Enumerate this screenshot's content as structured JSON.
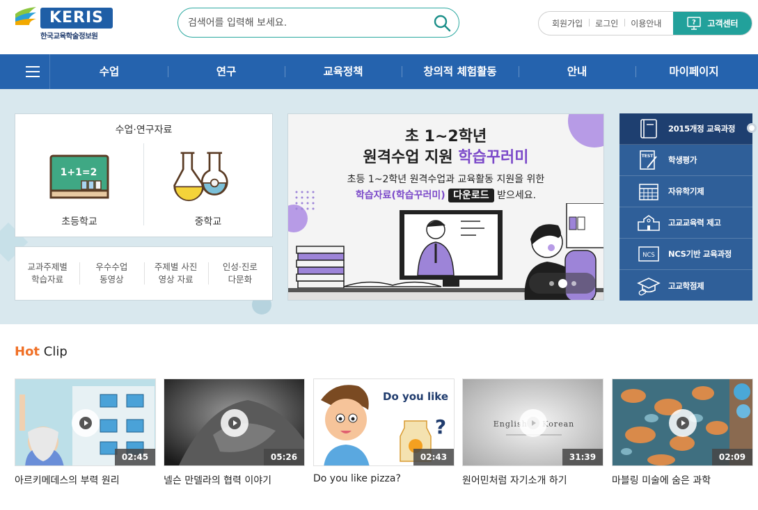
{
  "header": {
    "logo_text": "KERIS",
    "logo_subtitle": "한국교육학술정보원",
    "search_placeholder": "검색어를 입력해 보세요.",
    "util_links": [
      "회원가입",
      "로그인",
      "이용안내"
    ],
    "customer_center": "고객센터"
  },
  "nav": {
    "items": [
      "수업",
      "연구",
      "교육정책",
      "창의적 체험활동",
      "안내",
      "마이페이지"
    ]
  },
  "resources": {
    "title": "수업·연구자료",
    "items": [
      "초등학교",
      "중학교"
    ],
    "board_text": "1+1=2",
    "links": [
      {
        "line1": "교과주제별",
        "line2": "학습자료"
      },
      {
        "line1": "우수수업",
        "line2": "동영상"
      },
      {
        "line1": "주제별 사진",
        "line2": "영상 자료"
      },
      {
        "line1": "인성·진로",
        "line2": "다문화"
      }
    ]
  },
  "banner": {
    "line1": "초 1~2학년",
    "line2_pre": "원격수업 지원 ",
    "line2_highlight": "학습꾸러미",
    "line3": "초등 1~2학년 원격수업과 교육활동 지원을 위한",
    "line4_highlight": "학습자료(학습꾸러미)",
    "line4_button": "다운로드",
    "line4_post": "받으세요.",
    "slides": 3,
    "active_slide": 2
  },
  "quick_menu": {
    "items": [
      {
        "label": "2015개정 교육과정",
        "icon": "book-icon",
        "active": true
      },
      {
        "label": "학생평가",
        "icon": "test-paper-icon",
        "active": false
      },
      {
        "label": "자유학기제",
        "icon": "calendar-icon",
        "active": false
      },
      {
        "label": "고교교육력 제고",
        "icon": "school-building-icon",
        "active": false
      },
      {
        "label": "NCS기반 교육과정",
        "icon": "ncs-icon",
        "active": false
      },
      {
        "label": "고교학점제",
        "icon": "graduation-cap-icon",
        "active": false
      }
    ],
    "ncs_badge": "NCS",
    "test_badge": "TEST"
  },
  "hot_clip": {
    "title_accent": "Hot",
    "title_rest": " Clip",
    "clips": [
      {
        "title": "아르키메데스의 부력 원리",
        "duration": "02:45",
        "overlay": ""
      },
      {
        "title": "넬슨 만델라의 협력 이야기",
        "duration": "05:26",
        "overlay": ""
      },
      {
        "title": "Do you like pizza?",
        "duration": "02:43",
        "overlay": "Do you like"
      },
      {
        "title": "원어민처럼 자기소개 하기",
        "duration": "31:39",
        "overlay": "English in Korean"
      },
      {
        "title": "마블링 미술에 숨은 과학",
        "duration": "02:09",
        "overlay": ""
      }
    ]
  },
  "colors": {
    "brand_blue": "#2563ae",
    "teal": "#22a19b",
    "purple": "#7b49c9",
    "hot_orange": "#f07026",
    "quick_bg": "#2f5f99"
  }
}
